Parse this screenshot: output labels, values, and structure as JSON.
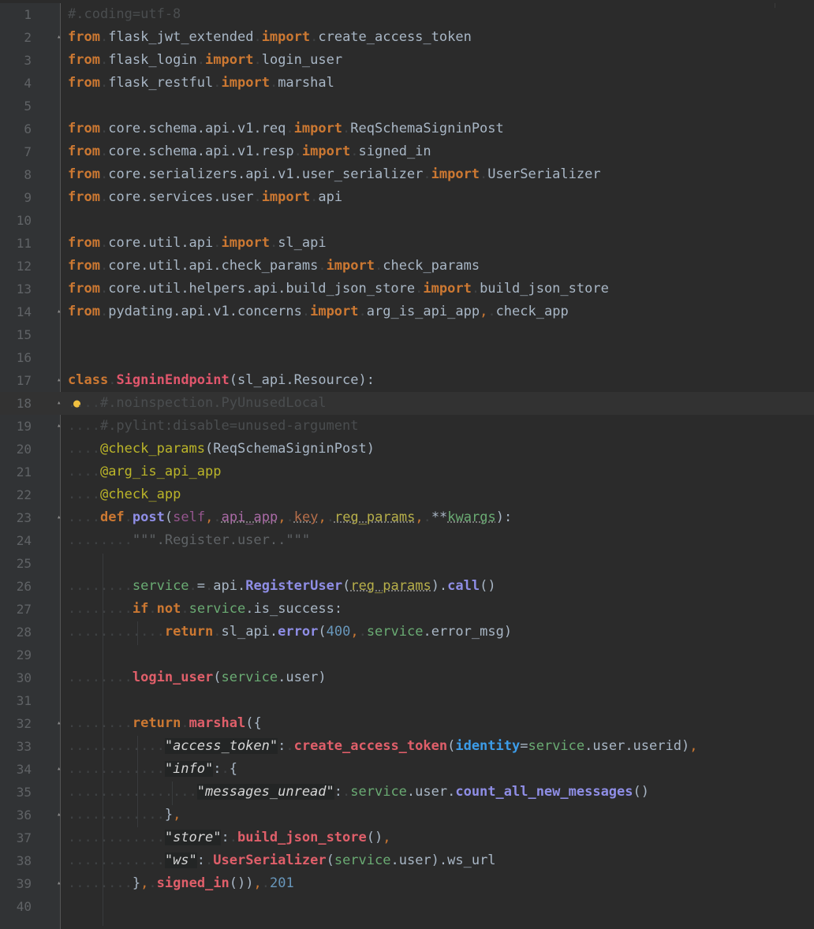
{
  "editor": {
    "language": "python",
    "current_line": 18,
    "lines": [
      {
        "n": "1",
        "tokens": [
          [
            "cm",
            "#.coding=utf-8"
          ]
        ]
      },
      {
        "n": "2",
        "fold": true,
        "tokens": [
          [
            "kw",
            "from"
          ],
          [
            "ws",
            "."
          ],
          [
            "",
            "flask_jwt_extended"
          ],
          [
            "ws",
            "."
          ],
          [
            "kw",
            "import"
          ],
          [
            "ws",
            "."
          ],
          [
            "",
            "create_access_token"
          ]
        ]
      },
      {
        "n": "3",
        "tokens": [
          [
            "kw",
            "from"
          ],
          [
            "ws",
            "."
          ],
          [
            "",
            "flask_login"
          ],
          [
            "ws",
            "."
          ],
          [
            "kw",
            "import"
          ],
          [
            "ws",
            "."
          ],
          [
            "",
            "login_user"
          ]
        ]
      },
      {
        "n": "4",
        "tokens": [
          [
            "kw",
            "from"
          ],
          [
            "ws",
            "."
          ],
          [
            "",
            "flask_restful"
          ],
          [
            "ws",
            "."
          ],
          [
            "kw",
            "import"
          ],
          [
            "ws",
            "."
          ],
          [
            "",
            "marshal"
          ]
        ]
      },
      {
        "n": "5",
        "tokens": []
      },
      {
        "n": "6",
        "tokens": [
          [
            "kw",
            "from"
          ],
          [
            "ws",
            "."
          ],
          [
            "",
            "core.schema.api.v1.req"
          ],
          [
            "ws",
            "."
          ],
          [
            "kw",
            "import"
          ],
          [
            "ws",
            "."
          ],
          [
            "",
            "ReqSchemaSigninPost"
          ]
        ]
      },
      {
        "n": "7",
        "tokens": [
          [
            "kw",
            "from"
          ],
          [
            "ws",
            "."
          ],
          [
            "",
            "core.schema.api.v1.resp"
          ],
          [
            "ws",
            "."
          ],
          [
            "kw",
            "import"
          ],
          [
            "ws",
            "."
          ],
          [
            "",
            "signed_in"
          ]
        ]
      },
      {
        "n": "8",
        "tokens": [
          [
            "kw",
            "from"
          ],
          [
            "ws",
            "."
          ],
          [
            "",
            "core.serializers.api.v1.user_serializer"
          ],
          [
            "ws",
            "."
          ],
          [
            "kw",
            "import"
          ],
          [
            "ws",
            "."
          ],
          [
            "",
            "UserSerializer"
          ]
        ]
      },
      {
        "n": "9",
        "tokens": [
          [
            "kw",
            "from"
          ],
          [
            "ws",
            "."
          ],
          [
            "",
            "core.services.user"
          ],
          [
            "ws",
            "."
          ],
          [
            "kw",
            "import"
          ],
          [
            "ws",
            "."
          ],
          [
            "",
            "api"
          ]
        ]
      },
      {
        "n": "10",
        "tokens": []
      },
      {
        "n": "11",
        "tokens": [
          [
            "kw",
            "from"
          ],
          [
            "ws",
            "."
          ],
          [
            "",
            "core.util.api"
          ],
          [
            "ws",
            "."
          ],
          [
            "kw",
            "import"
          ],
          [
            "ws",
            "."
          ],
          [
            "",
            "sl_api"
          ]
        ]
      },
      {
        "n": "12",
        "tokens": [
          [
            "kw",
            "from"
          ],
          [
            "ws",
            "."
          ],
          [
            "",
            "core.util.api.check_params"
          ],
          [
            "ws",
            "."
          ],
          [
            "kw",
            "import"
          ],
          [
            "ws",
            "."
          ],
          [
            "",
            "check_params"
          ]
        ]
      },
      {
        "n": "13",
        "tokens": [
          [
            "kw",
            "from"
          ],
          [
            "ws",
            "."
          ],
          [
            "",
            "core.util.helpers.api.build_json_store"
          ],
          [
            "ws",
            "."
          ],
          [
            "kw",
            "import"
          ],
          [
            "ws",
            "."
          ],
          [
            "",
            "build_json_store"
          ]
        ]
      },
      {
        "n": "14",
        "fold": true,
        "tokens": [
          [
            "kw",
            "from"
          ],
          [
            "ws",
            "."
          ],
          [
            "",
            "pydating.api.v1.concerns"
          ],
          [
            "ws",
            "."
          ],
          [
            "kw",
            "import"
          ],
          [
            "ws",
            "."
          ],
          [
            "",
            "arg_is_api_app"
          ],
          [
            "op",
            ","
          ],
          [
            "ws",
            "."
          ],
          [
            "",
            "check_app"
          ]
        ]
      },
      {
        "n": "15",
        "tokens": []
      },
      {
        "n": "16",
        "tokens": []
      },
      {
        "n": "17",
        "fold": true,
        "tokens": [
          [
            "kw",
            "class"
          ],
          [
            "ws",
            "."
          ],
          [
            "cls",
            "SigninEndpoint"
          ],
          [
            "",
            "(sl_api.Resource):"
          ]
        ]
      },
      {
        "n": "18",
        "fold": true,
        "bulb": true,
        "tokens": [
          [
            "ws",
            "...."
          ],
          [
            "cm",
            "#.noinspection.PyUnusedLocal"
          ]
        ]
      },
      {
        "n": "19",
        "fold": true,
        "tokens": [
          [
            "ws",
            "...."
          ],
          [
            "cm",
            "#.pylint:disable=unused-argument"
          ]
        ]
      },
      {
        "n": "20",
        "tokens": [
          [
            "ws",
            "...."
          ],
          [
            "dec",
            "@check_params"
          ],
          [
            "",
            "(ReqSchemaSigninPost)"
          ]
        ]
      },
      {
        "n": "21",
        "tokens": [
          [
            "ws",
            "...."
          ],
          [
            "dec",
            "@arg_is_api_app"
          ]
        ]
      },
      {
        "n": "22",
        "tokens": [
          [
            "ws",
            "...."
          ],
          [
            "dec",
            "@check_app"
          ]
        ]
      },
      {
        "n": "23",
        "fold": true,
        "tokens": [
          [
            "ws",
            "...."
          ],
          [
            "kw",
            "def"
          ],
          [
            "ws",
            "."
          ],
          [
            "meth",
            "post"
          ],
          [
            "",
            "("
          ],
          [
            "self",
            "self"
          ],
          [
            "op",
            ","
          ],
          [
            "ws",
            "."
          ],
          [
            "p1",
            "api_app"
          ],
          [
            "op",
            ","
          ],
          [
            "ws",
            "."
          ],
          [
            "p2",
            "key"
          ],
          [
            "op",
            ","
          ],
          [
            "ws",
            "."
          ],
          [
            "param",
            "reg_params"
          ],
          [
            "op",
            ","
          ],
          [
            "ws",
            "."
          ],
          [
            "",
            "**"
          ],
          [
            "p3",
            "kwargs"
          ],
          [
            "",
            "):"
          ]
        ]
      },
      {
        "n": "24",
        "tokens": [
          [
            "ws",
            "........"
          ],
          [
            "doc",
            "\"\"\".Register.user..\"\"\""
          ]
        ]
      },
      {
        "n": "25",
        "tokens": []
      },
      {
        "n": "26",
        "tokens": [
          [
            "ws",
            "........"
          ],
          [
            "var",
            "service"
          ],
          [
            "ws",
            "."
          ],
          [
            "",
            "="
          ],
          [
            "ws",
            "."
          ],
          [
            "",
            "api."
          ],
          [
            "meth",
            "RegisterUser"
          ],
          [
            "",
            "("
          ],
          [
            "param",
            "reg_params"
          ],
          [
            "",
            ")."
          ],
          [
            "meth",
            "call"
          ],
          [
            "",
            "()"
          ]
        ]
      },
      {
        "n": "27",
        "tokens": [
          [
            "ws",
            "........"
          ],
          [
            "kw",
            "if"
          ],
          [
            "ws",
            "."
          ],
          [
            "kw",
            "not"
          ],
          [
            "ws",
            "."
          ],
          [
            "var",
            "service"
          ],
          [
            "",
            ".is_success:"
          ]
        ]
      },
      {
        "n": "28",
        "tokens": [
          [
            "ws",
            "............"
          ],
          [
            "kw",
            "return"
          ],
          [
            "ws",
            "."
          ],
          [
            "",
            "sl_api."
          ],
          [
            "meth",
            "error"
          ],
          [
            "",
            "("
          ],
          [
            "num",
            "400"
          ],
          [
            "op",
            ","
          ],
          [
            "ws",
            "."
          ],
          [
            "var",
            "service"
          ],
          [
            "",
            ".error_msg)"
          ]
        ]
      },
      {
        "n": "29",
        "tokens": []
      },
      {
        "n": "30",
        "tokens": [
          [
            "ws",
            "........"
          ],
          [
            "fn",
            "login_user"
          ],
          [
            "",
            "("
          ],
          [
            "var",
            "service"
          ],
          [
            "",
            ".user)"
          ]
        ]
      },
      {
        "n": "31",
        "tokens": []
      },
      {
        "n": "32",
        "fold": true,
        "tokens": [
          [
            "ws",
            "........"
          ],
          [
            "kw",
            "return"
          ],
          [
            "ws",
            "."
          ],
          [
            "fn",
            "marshal"
          ],
          [
            "",
            "({"
          ]
        ]
      },
      {
        "n": "33",
        "tokens": [
          [
            "ws",
            "............"
          ],
          [
            "str",
            "\"access_token\""
          ],
          [
            "",
            ":"
          ],
          [
            "ws",
            "."
          ],
          [
            "fn",
            "create_access_token"
          ],
          [
            "",
            "("
          ],
          [
            "kwarg",
            "identity"
          ],
          [
            "",
            "="
          ],
          [
            "var",
            "service"
          ],
          [
            "",
            ".user.userid)"
          ],
          [
            "op",
            ","
          ]
        ]
      },
      {
        "n": "34",
        "fold": true,
        "tokens": [
          [
            "ws",
            "............"
          ],
          [
            "str",
            "\"info\""
          ],
          [
            "",
            ":"
          ],
          [
            "ws",
            "."
          ],
          [
            "",
            "{"
          ]
        ]
      },
      {
        "n": "35",
        "tokens": [
          [
            "ws",
            "................"
          ],
          [
            "str",
            "\"messages_unread\""
          ],
          [
            "",
            ":"
          ],
          [
            "ws",
            "."
          ],
          [
            "var",
            "service"
          ],
          [
            "",
            ".user."
          ],
          [
            "meth",
            "count_all_new_messages"
          ],
          [
            "",
            "()"
          ]
        ]
      },
      {
        "n": "36",
        "fold": true,
        "tokens": [
          [
            "ws",
            "............"
          ],
          [
            "",
            "}"
          ],
          [
            "op",
            ","
          ]
        ]
      },
      {
        "n": "37",
        "tokens": [
          [
            "ws",
            "............"
          ],
          [
            "str",
            "\"store\""
          ],
          [
            "",
            ":"
          ],
          [
            "ws",
            "."
          ],
          [
            "fn",
            "build_json_store"
          ],
          [
            "",
            "()"
          ],
          [
            "op",
            ","
          ]
        ]
      },
      {
        "n": "38",
        "tokens": [
          [
            "ws",
            "............"
          ],
          [
            "str",
            "\"ws\""
          ],
          [
            "",
            ":"
          ],
          [
            "ws",
            "."
          ],
          [
            "fn",
            "UserSerializer"
          ],
          [
            "",
            "("
          ],
          [
            "var",
            "service"
          ],
          [
            "",
            ".user).ws_url"
          ]
        ]
      },
      {
        "n": "39",
        "fold": true,
        "tokens": [
          [
            "ws",
            "........"
          ],
          [
            "",
            "}"
          ],
          [
            "op",
            ","
          ],
          [
            "ws",
            "."
          ],
          [
            "fn",
            "signed_in"
          ],
          [
            "",
            "())"
          ],
          [
            "op",
            ","
          ],
          [
            "ws",
            "."
          ],
          [
            "num",
            "201"
          ]
        ]
      },
      {
        "n": "40",
        "tokens": []
      }
    ]
  }
}
